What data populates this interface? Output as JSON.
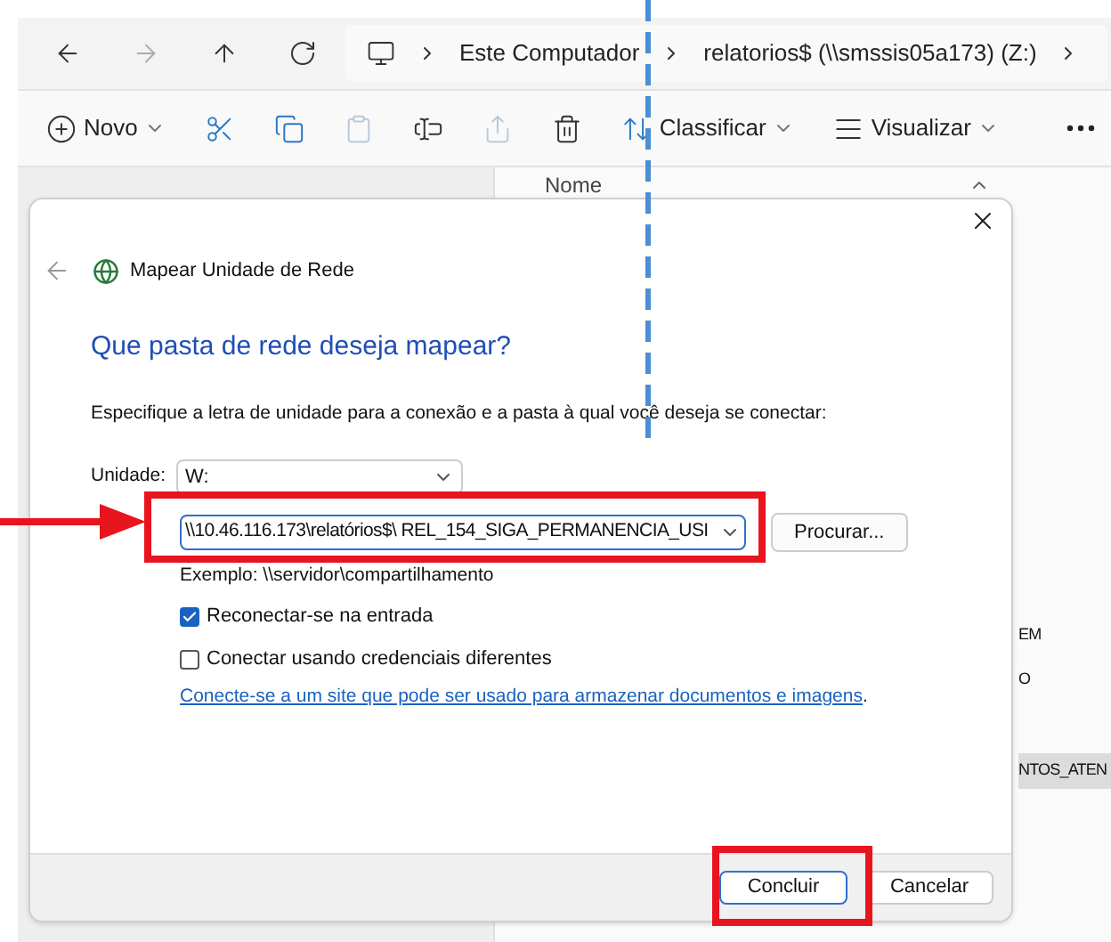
{
  "address_bar": {
    "crumbs": [
      "Este Computador",
      "relatorios$ (\\\\smssis05a173) (Z:)"
    ]
  },
  "toolbar": [
    {
      "kind": "new",
      "label": "Novo",
      "disabled": false
    },
    {
      "kind": "cut",
      "disabled": false
    },
    {
      "kind": "copy",
      "disabled": false
    },
    {
      "kind": "paste",
      "disabled": true
    },
    {
      "kind": "rename",
      "disabled": false
    },
    {
      "kind": "share",
      "disabled": true
    },
    {
      "kind": "delete",
      "disabled": false
    },
    {
      "kind": "sort",
      "label": "Classificar",
      "disabled": false
    },
    {
      "kind": "view",
      "label": "Visualizar",
      "disabled": false
    },
    {
      "kind": "more",
      "disabled": false
    }
  ],
  "file_list": {
    "column": "Nome",
    "rows": [
      {
        "name": "EM",
        "selected": false
      },
      {
        "name": "O",
        "selected": false
      },
      {
        "name": "NTOS_ATEN",
        "selected": true
      }
    ]
  },
  "dialog": {
    "title": "Mapear Unidade de Rede",
    "heading": "Que pasta de rede deseja mapear?",
    "instruction": "Especifique a letra de unidade para a conexão e a pasta à qual você deseja se conectar:",
    "drive_label": "Unidade:",
    "drive_value": "W:",
    "folder_value": "\\\\10.46.116.173\\relatórios$\\ REL_154_SIGA_PERMANENCIA_USI",
    "browse": "Procurar...",
    "example": "Exemplo: \\\\servidor\\compartilhamento",
    "checkboxes": [
      {
        "label": "Reconectar-se na entrada",
        "checked": true
      },
      {
        "label": "Conectar usando credenciais diferentes",
        "checked": false
      }
    ],
    "link": "Conecte-se a um site que pode ser usado para armazenar documentos e imagens",
    "link_tail": ".",
    "buttons": [
      {
        "label": "Concluir",
        "default": true
      },
      {
        "label": "Cancelar",
        "default": false
      }
    ]
  }
}
